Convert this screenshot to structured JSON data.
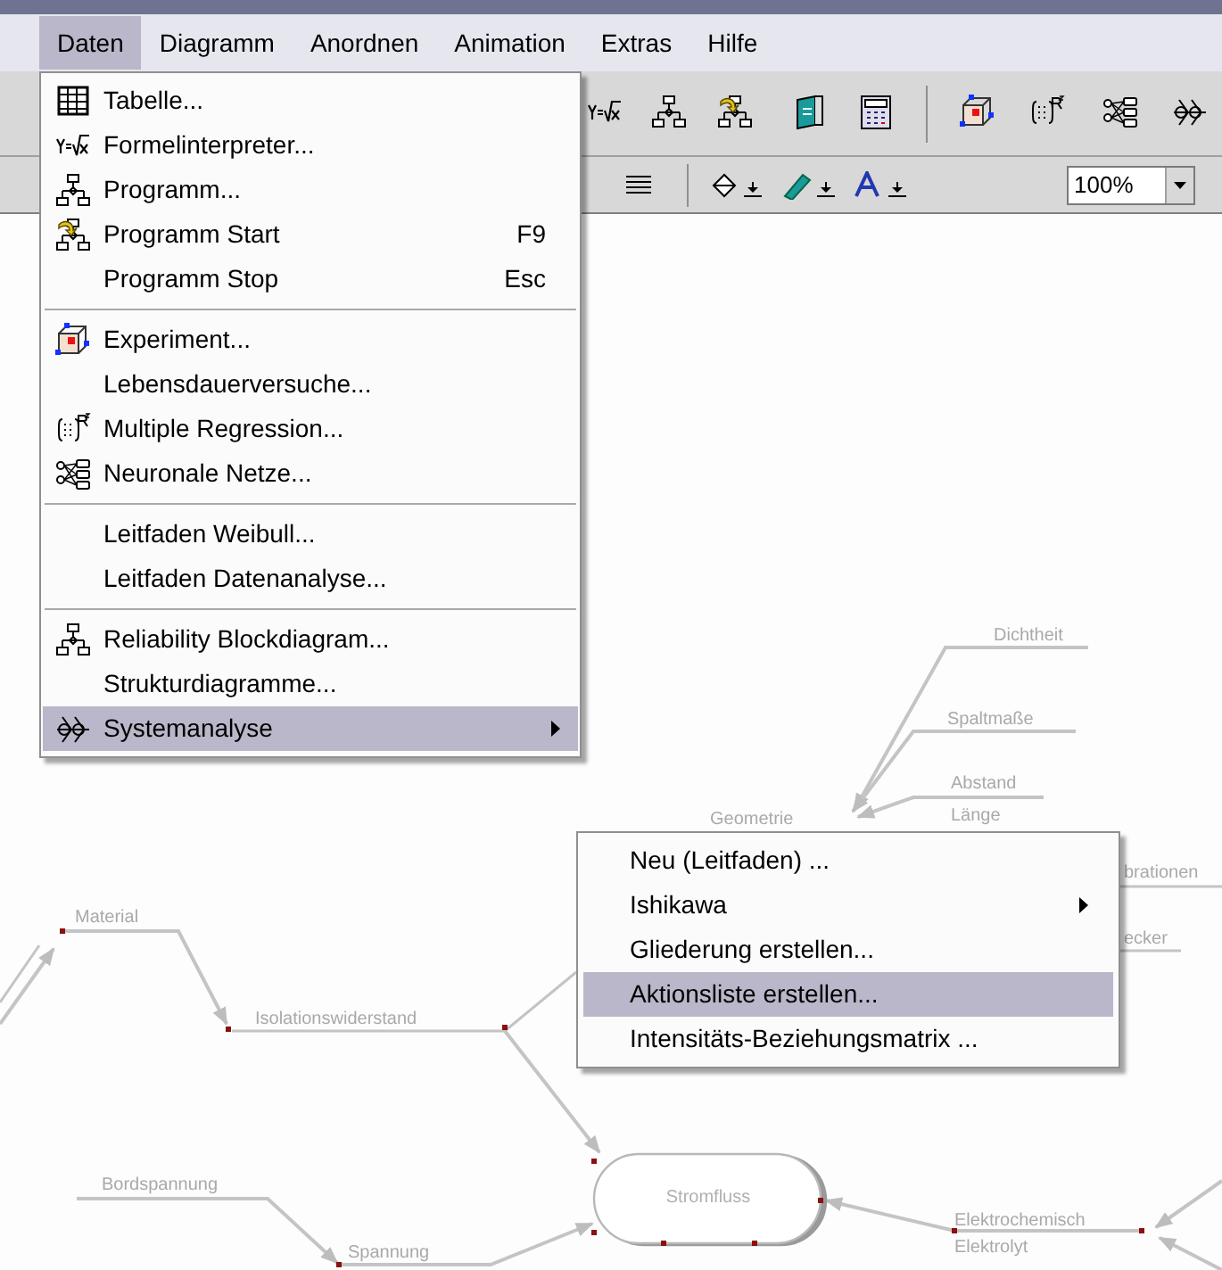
{
  "menu_bar": [
    {
      "label": "Daten",
      "selected": true
    },
    {
      "label": "Diagramm",
      "selected": false
    },
    {
      "label": "Anordnen",
      "selected": false
    },
    {
      "label": "Animation",
      "selected": false
    },
    {
      "label": "Extras",
      "selected": false
    },
    {
      "label": "Hilfe",
      "selected": false
    }
  ],
  "daten_menu": {
    "items": [
      {
        "kind": "item",
        "label": "Tabelle...",
        "selected": false
      },
      {
        "kind": "item",
        "label": "Formelinterpreter...",
        "selected": false
      },
      {
        "kind": "item",
        "label": "Programm...",
        "selected": false
      },
      {
        "kind": "item",
        "label": "Programm Start",
        "shortcut": "F9",
        "selected": false
      },
      {
        "kind": "item",
        "label": "Programm Stop",
        "shortcut": "Esc",
        "selected": false
      },
      {
        "kind": "separator"
      },
      {
        "kind": "item",
        "label": "Experiment...",
        "selected": false
      },
      {
        "kind": "item",
        "label": "Lebensdauerversuche...",
        "selected": false
      },
      {
        "kind": "item",
        "label": "Multiple Regression...",
        "selected": false
      },
      {
        "kind": "item",
        "label": "Neuronale Netze...",
        "selected": false
      },
      {
        "kind": "separator"
      },
      {
        "kind": "item",
        "label": "Leitfaden Weibull...",
        "selected": false
      },
      {
        "kind": "item",
        "label": "Leitfaden Datenanalyse...",
        "selected": false
      },
      {
        "kind": "separator"
      },
      {
        "kind": "item",
        "label": "Reliability Blockdiagram...",
        "selected": false
      },
      {
        "kind": "item",
        "label": "Strukturdiagramme...",
        "selected": false
      },
      {
        "kind": "item",
        "label": "Systemanalyse",
        "selected": true,
        "submenu": true
      }
    ]
  },
  "systemanalyse_menu": {
    "items": [
      {
        "label": "Neu (Leitfaden) ...",
        "selected": false
      },
      {
        "label": "Ishikawa",
        "selected": false,
        "submenu": true
      },
      {
        "label": "Gliederung erstellen...",
        "selected": false
      },
      {
        "label": "Aktionsliste erstellen...",
        "selected": true
      },
      {
        "label": "Intensitäts-Beziehungsmatrix ...",
        "selected": false
      }
    ]
  },
  "zoom": {
    "value": "100%"
  },
  "diagram": {
    "labels": [
      {
        "text": "Dichtheit"
      },
      {
        "text": "Spaltmaße"
      },
      {
        "text": "Abstand"
      },
      {
        "text": "Länge"
      },
      {
        "text": "Geometrie"
      },
      {
        "text": "brationen"
      },
      {
        "text": "ecker"
      },
      {
        "text": "Material"
      },
      {
        "text": "Isolationswiderstand"
      },
      {
        "text": "Bordspannung"
      },
      {
        "text": "Stromfluss",
        "kind": "node"
      },
      {
        "text": "Spannung"
      },
      {
        "text": "Elektrochemisch"
      },
      {
        "text": "Elektrolyt"
      }
    ]
  }
}
